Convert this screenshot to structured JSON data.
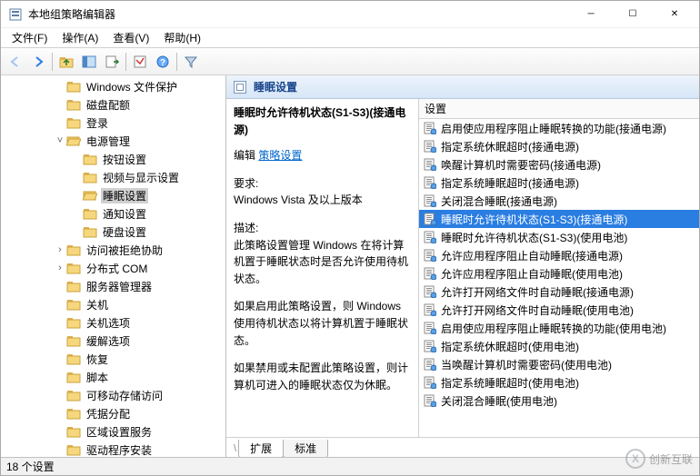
{
  "title": "本地组策略编辑器",
  "menu": {
    "file": "文件(F)",
    "action": "操作(A)",
    "view": "查看(V)",
    "help": "帮助(H)"
  },
  "tree": {
    "items": [
      {
        "label": "Windows 文件保护",
        "depth": 3
      },
      {
        "label": "磁盘配额",
        "depth": 3
      },
      {
        "label": "登录",
        "depth": 3
      },
      {
        "label": "电源管理",
        "depth": 3,
        "expanded": true
      },
      {
        "label": "按钮设置",
        "depth": 4
      },
      {
        "label": "视频与显示设置",
        "depth": 4
      },
      {
        "label": "睡眠设置",
        "depth": 4,
        "selected": true
      },
      {
        "label": "通知设置",
        "depth": 4
      },
      {
        "label": "硬盘设置",
        "depth": 4
      },
      {
        "label": "访问被拒绝协助",
        "depth": 3,
        "expander": true
      },
      {
        "label": "分布式 COM",
        "depth": 3,
        "expander": true
      },
      {
        "label": "服务器管理器",
        "depth": 3
      },
      {
        "label": "关机",
        "depth": 3
      },
      {
        "label": "关机选项",
        "depth": 3
      },
      {
        "label": "缓解选项",
        "depth": 3
      },
      {
        "label": "恢复",
        "depth": 3
      },
      {
        "label": "脚本",
        "depth": 3
      },
      {
        "label": "可移动存储访问",
        "depth": 3
      },
      {
        "label": "凭据分配",
        "depth": 3
      },
      {
        "label": "区域设置服务",
        "depth": 3
      },
      {
        "label": "驱动程序安装",
        "depth": 3
      }
    ]
  },
  "header": "睡眠设置",
  "desc": {
    "title": "睡眠时允许待机状态(S1-S3)(接通电源)",
    "edit_prefix": "编辑",
    "edit_link": "策略设置",
    "req_label": "要求:",
    "req_value": "Windows Vista 及以上版本",
    "d_label": "描述:",
    "d_p1": "此策略设置管理 Windows 在将计算机置于睡眠状态时是否允许使用待机状态。",
    "d_p2": "如果启用此策略设置，则 Windows 使用待机状态以将计算机置于睡眠状态。",
    "d_p3": "如果禁用或未配置此策略设置，则计算机可进入的睡眠状态仅为休眠。"
  },
  "list": {
    "col": "设置",
    "items": [
      "启用使应用程序阻止睡眠转换的功能(接通电源)",
      "指定系统休眠超时(接通电源)",
      "唤醒计算机时需要密码(接通电源)",
      "指定系统睡眠超时(接通电源)",
      "关闭混合睡眠(接通电源)",
      "睡眠时允许待机状态(S1-S3)(接通电源)",
      "睡眠时允许待机状态(S1-S3)(使用电池)",
      "允许应用程序阻止自动睡眠(接通电源)",
      "允许应用程序阻止自动睡眠(使用电池)",
      "允许打开网络文件时自动睡眠(接通电源)",
      "允许打开网络文件时自动睡眠(使用电池)",
      "启用使应用程序阻止睡眠转换的功能(使用电池)",
      "指定系统休眠超时(使用电池)",
      "当唤醒计算机时需要密码(使用电池)",
      "指定系统睡眠超时(使用电池)",
      "关闭混合睡眠(使用电池)"
    ],
    "selected_index": 5
  },
  "tabs": {
    "extended": "扩展",
    "standard": "标准"
  },
  "status": "18 个设置",
  "watermark": "创新互联"
}
